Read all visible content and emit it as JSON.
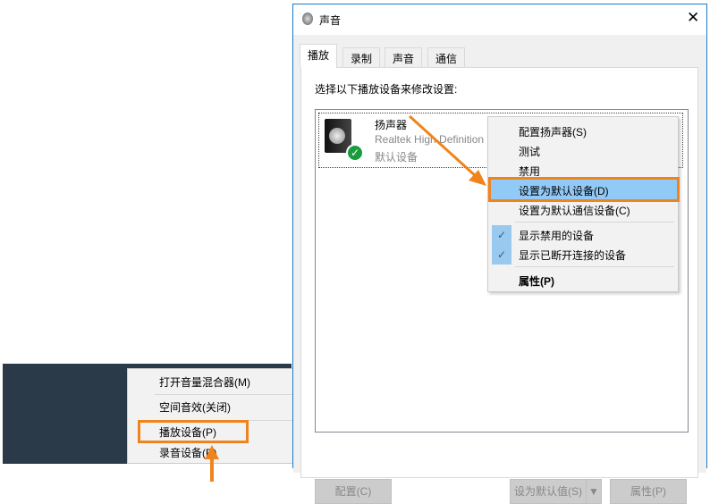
{
  "tray_menu": {
    "items": [
      "打开音量混合器(M)",
      "空间音效(关闭)",
      "播放设备(P)",
      "录音设备(R)"
    ],
    "highlighted": "播放设备(P)"
  },
  "dialog": {
    "title": "声音",
    "tabs": [
      "播放",
      "录制",
      "声音",
      "通信"
    ],
    "active_tab": "播放",
    "instruction": "选择以下播放设备来修改设置:",
    "device": {
      "name": "扬声器",
      "driver": "Realtek High Definition",
      "status": "默认设备"
    },
    "buttons": {
      "configure": "配置(C)",
      "set_default": "设为默认值(S)",
      "properties": "属性(P)"
    }
  },
  "context_menu": {
    "items": [
      "配置扬声器(S)",
      "测试",
      "禁用",
      "设置为默认设备(D)",
      "设置为默认通信设备(C)"
    ],
    "checked_items": [
      "显示禁用的设备",
      "显示已断开连接的设备"
    ],
    "properties": "属性(P)"
  },
  "colors": {
    "highlight": "#f0841c",
    "selection": "#91c9f7",
    "taskbar": "#2b3a48"
  }
}
